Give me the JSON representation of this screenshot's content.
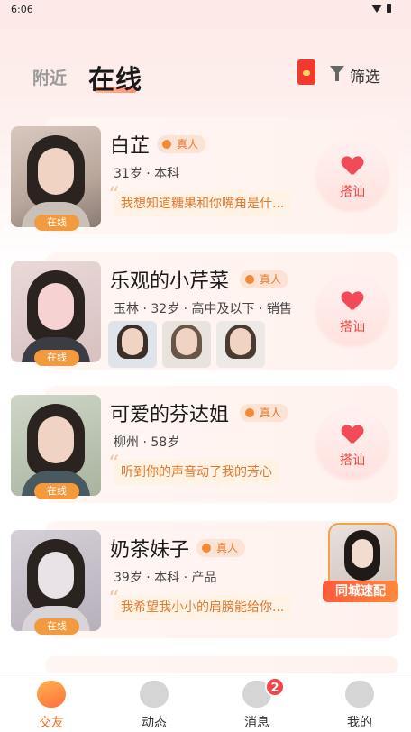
{
  "status_bar": {
    "time": "6:06",
    "icons": [
      "wifi-icon",
      "battery-icon"
    ]
  },
  "header": {
    "tabs": [
      {
        "label": "附近",
        "active": false
      },
      {
        "label": "在线",
        "active": true
      }
    ],
    "red_packet_icon": "red-packet-icon",
    "filter_label": "筛选"
  },
  "colors": {
    "accent": "#f0702e",
    "greet": "#e8463f",
    "online_badge": "#f39a3f"
  },
  "users": [
    {
      "name": "白芷",
      "verified_label": "真人",
      "online_label": "在线",
      "info": "31岁 · 本科",
      "quote": "我想知道糖果和你嘴角是什...",
      "action": {
        "type": "greet",
        "label": "搭讪"
      }
    },
    {
      "name": "乐观的小芹菜",
      "verified_label": "真人",
      "online_label": "在线",
      "info": "玉林 · 32岁 · 高中及以下 · 销售",
      "photos": [
        "photo-1",
        "photo-2",
        "photo-3"
      ],
      "action": {
        "type": "greet",
        "label": "搭讪"
      }
    },
    {
      "name": "可爱的芬达姐",
      "verified_label": "真人",
      "online_label": "在线",
      "info": "柳州 · 58岁",
      "quote": "听到你的声音动了我的芳心",
      "action": {
        "type": "greet",
        "label": "搭讪"
      }
    },
    {
      "name": "奶茶妹子",
      "verified_label": "真人",
      "online_label": "在线",
      "info": "39岁 · 本科 · 产品",
      "quote": "我希望我小小的肩膀能给你...",
      "action": {
        "type": "match",
        "label": "同城速配"
      }
    }
  ],
  "tabbar": [
    {
      "label": "交友",
      "icon": "friends-icon",
      "active": true
    },
    {
      "label": "动态",
      "icon": "compass-icon",
      "active": false
    },
    {
      "label": "消息",
      "icon": "message-icon",
      "active": false,
      "badge": "2"
    },
    {
      "label": "我的",
      "icon": "profile-icon",
      "active": false
    }
  ]
}
